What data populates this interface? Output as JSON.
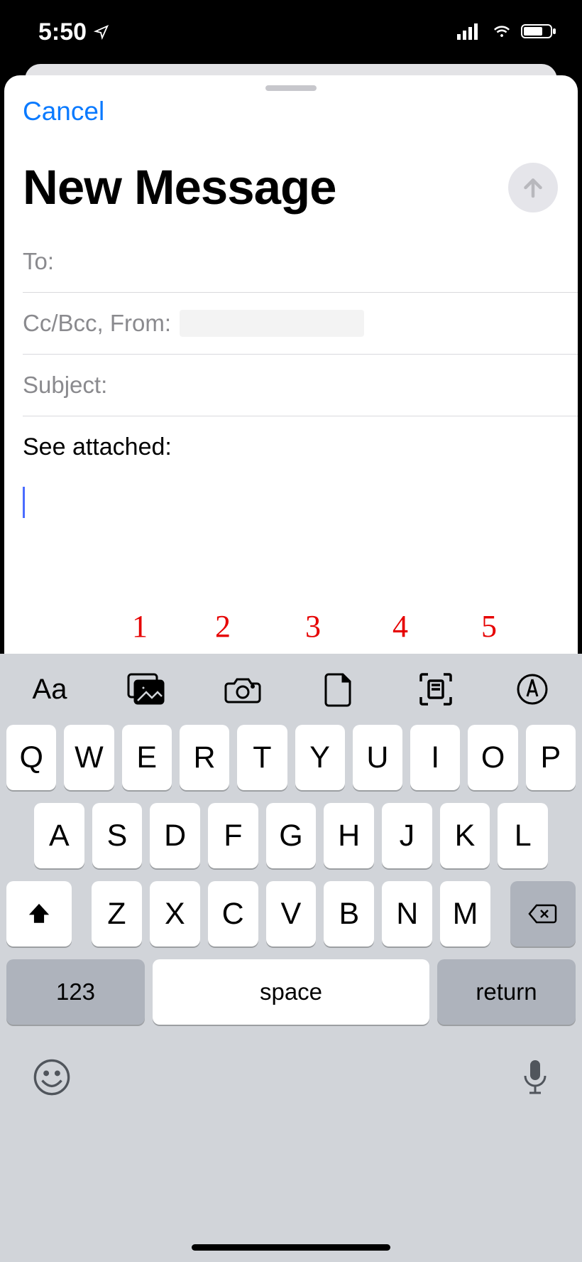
{
  "status": {
    "time": "5:50"
  },
  "compose": {
    "cancel": "Cancel",
    "title": "New Message",
    "to_label": "To:",
    "ccbcc_label": "Cc/Bcc, From:",
    "subject_label": "Subject:",
    "body_text": "See attached:"
  },
  "annotations": [
    "1",
    "2",
    "3",
    "4",
    "5"
  ],
  "toolbar_icons": {
    "format": "format-text-icon",
    "photos": "photo-library-icon",
    "camera": "camera-icon",
    "file": "attach-file-icon",
    "scan": "scan-document-icon",
    "markup": "markup-icon"
  },
  "keyboard": {
    "row1": [
      "Q",
      "W",
      "E",
      "R",
      "T",
      "Y",
      "U",
      "I",
      "O",
      "P"
    ],
    "row2": [
      "A",
      "S",
      "D",
      "F",
      "G",
      "H",
      "J",
      "K",
      "L"
    ],
    "row3": [
      "Z",
      "X",
      "C",
      "V",
      "B",
      "N",
      "M"
    ],
    "numbers": "123",
    "space": "space",
    "return": "return"
  }
}
